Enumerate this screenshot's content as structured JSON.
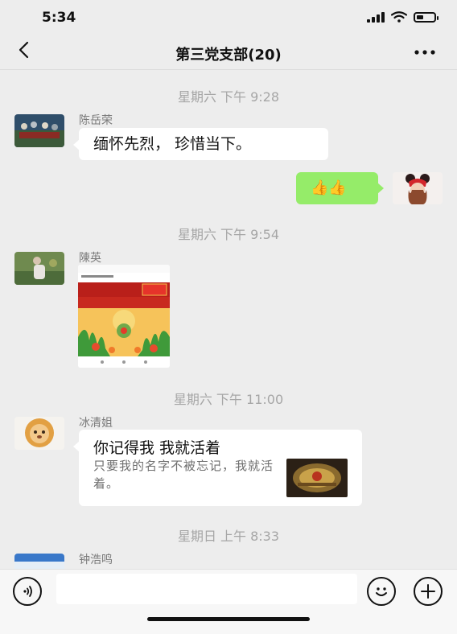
{
  "status": {
    "time": "5:34"
  },
  "nav": {
    "back": "<",
    "title": "第三党支部(20)",
    "more": "···"
  },
  "messages": {
    "sep1": "星期六 下午 9:28",
    "m1_sender": "陈岳荣",
    "m1_text": "缅怀先烈， 珍惜当下。",
    "m2_text": "👍👍",
    "sep2": "星期六 下午 9:54",
    "m3_sender": "陳英",
    "sep3": "星期六 下午 11:00",
    "m4_sender": "冰清姐",
    "m4_title": "你记得我 我就活着",
    "m4_desc": "只要我的名字不被忘记，我就活着。",
    "sep4": "星期日 上午 8:33",
    "m5_sender": "钟浩鸣"
  },
  "input": {
    "placeholder": ""
  },
  "colors": {
    "background": "#ededed",
    "self_bubble": "#95ec69",
    "other_bubble": "#ffffff"
  },
  "icons": [
    "chevron-left-icon",
    "more-icon",
    "voice-icon",
    "emoji-icon",
    "plus-icon",
    "wifi-icon",
    "battery-icon",
    "signal-icon"
  ]
}
